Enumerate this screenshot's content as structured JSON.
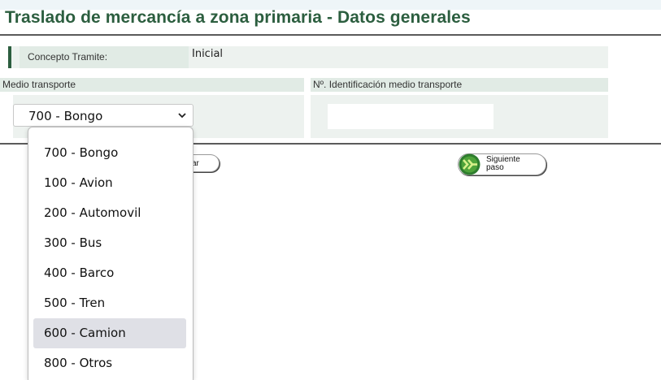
{
  "title": "Traslado de mercancía a zona primaria - Datos generales",
  "concepto": {
    "label": "Concepto Tramite:",
    "value": "Inicial"
  },
  "fields": {
    "medio_label": "Medio transporte",
    "id_label": "Nº. Identificación medio transporte",
    "medio_selected": "700 - Bongo",
    "id_value": ""
  },
  "buttons": {
    "left_partial_label": "ar",
    "next_label_line1": "Siguiente",
    "next_label_line2": "paso"
  },
  "dropdown": {
    "options": [
      "700 - Bongo",
      "100 - Avion",
      "200 - Automovil",
      "300 - Bus",
      "400 - Barco",
      "500 - Tren",
      "600 - Camion",
      "800 - Otros"
    ],
    "highlighted": "600 - Camion"
  },
  "colors": {
    "title_green": "#2c5e3f",
    "row_bg": "#edf2ef",
    "header_bg": "#e1ebe5",
    "highlight": "#dfe0e6"
  },
  "icons": {
    "select_arrow": "chevron-down-icon",
    "next_button": "double-arrow-right-icon"
  }
}
